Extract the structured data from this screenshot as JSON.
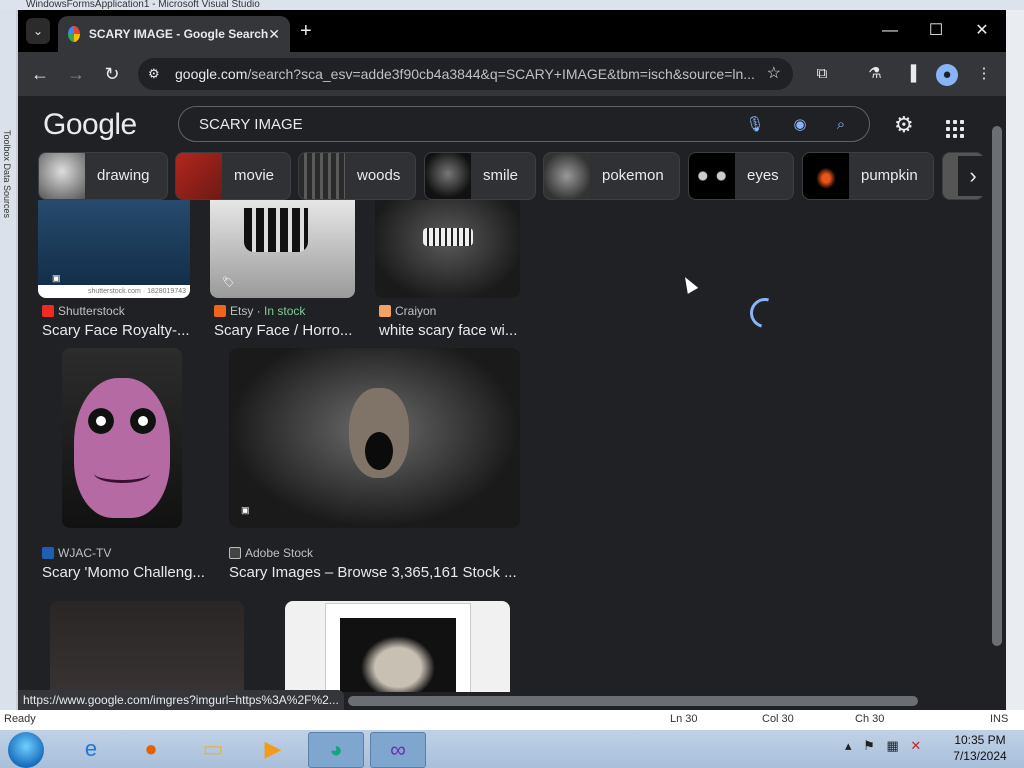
{
  "background_app": {
    "title": "WindowsFormsApplication1 - Microsoft Visual Studio",
    "left_label": "Toolbox  Data Sources",
    "status_ready": "Ready",
    "status_ln": "Ln 30",
    "status_col": "Col 30",
    "status_ch": "Ch 30",
    "status_ins": "INS"
  },
  "browser": {
    "tab_title": "SCARY IMAGE - Google Search",
    "tab_close": "✕",
    "new_tab": "+",
    "url_domain": "google.com",
    "url_path": "/search?sca_esv=adde3f90cb4a3844&q=SCARY+IMAGE&tbm=isch&source=ln...",
    "window_minimize": "—",
    "window_maximize": "☐",
    "window_close": "✕",
    "status_link": "https://www.google.com/imgres?imgurl=https%3A%2F%2..."
  },
  "google": {
    "logo": "Google",
    "search_value": "SCARY IMAGE",
    "chips": [
      {
        "label": "drawing"
      },
      {
        "label": "movie"
      },
      {
        "label": "woods"
      },
      {
        "label": "smile"
      },
      {
        "label": "pokemon"
      },
      {
        "label": "eyes"
      },
      {
        "label": "pumpkin"
      }
    ],
    "results": [
      {
        "source": "Shutterstock",
        "caption": "Scary Face Royalty-...",
        "watermark": "shutterstock.com · 1828019743"
      },
      {
        "source": "Etsy",
        "stock": "In stock",
        "caption": "Scary Face / Horro..."
      },
      {
        "source": "Craiyon",
        "caption": "white scary face wi..."
      },
      {
        "source": "WJAC-TV",
        "caption": "Scary 'Momo Challeng..."
      },
      {
        "source": "Adobe Stock",
        "caption": "Scary Images – Browse 3,365,161 Stock ..."
      }
    ]
  },
  "taskbar": {
    "time": "10:35 PM",
    "date": "7/13/2024"
  }
}
